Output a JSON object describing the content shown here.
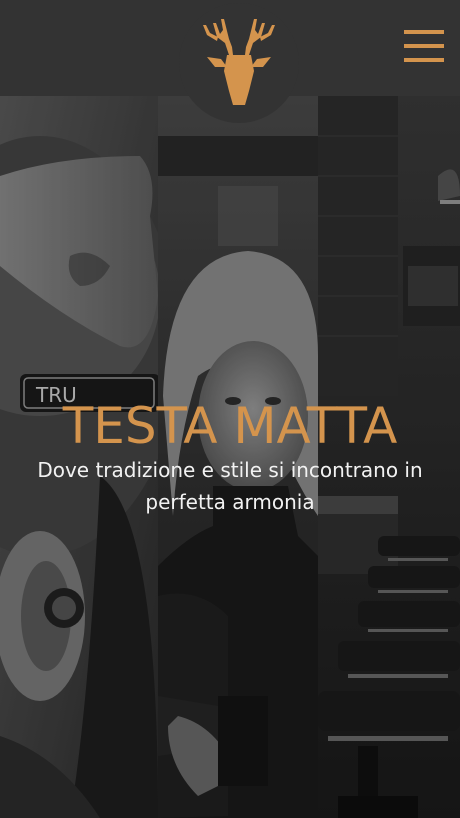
{
  "header": {
    "logo_icon": "deer-head-icon",
    "menu_icon": "hamburger-menu-icon"
  },
  "hero": {
    "title": "TESTA MATTA",
    "subtitle": "Dove tradizione e stile si incontrano in perfetta armonia",
    "razor_text": "TRU"
  },
  "colors": {
    "accent": "#d4944d",
    "header_bg": "#333333",
    "text_light": "#f2f2f2"
  }
}
